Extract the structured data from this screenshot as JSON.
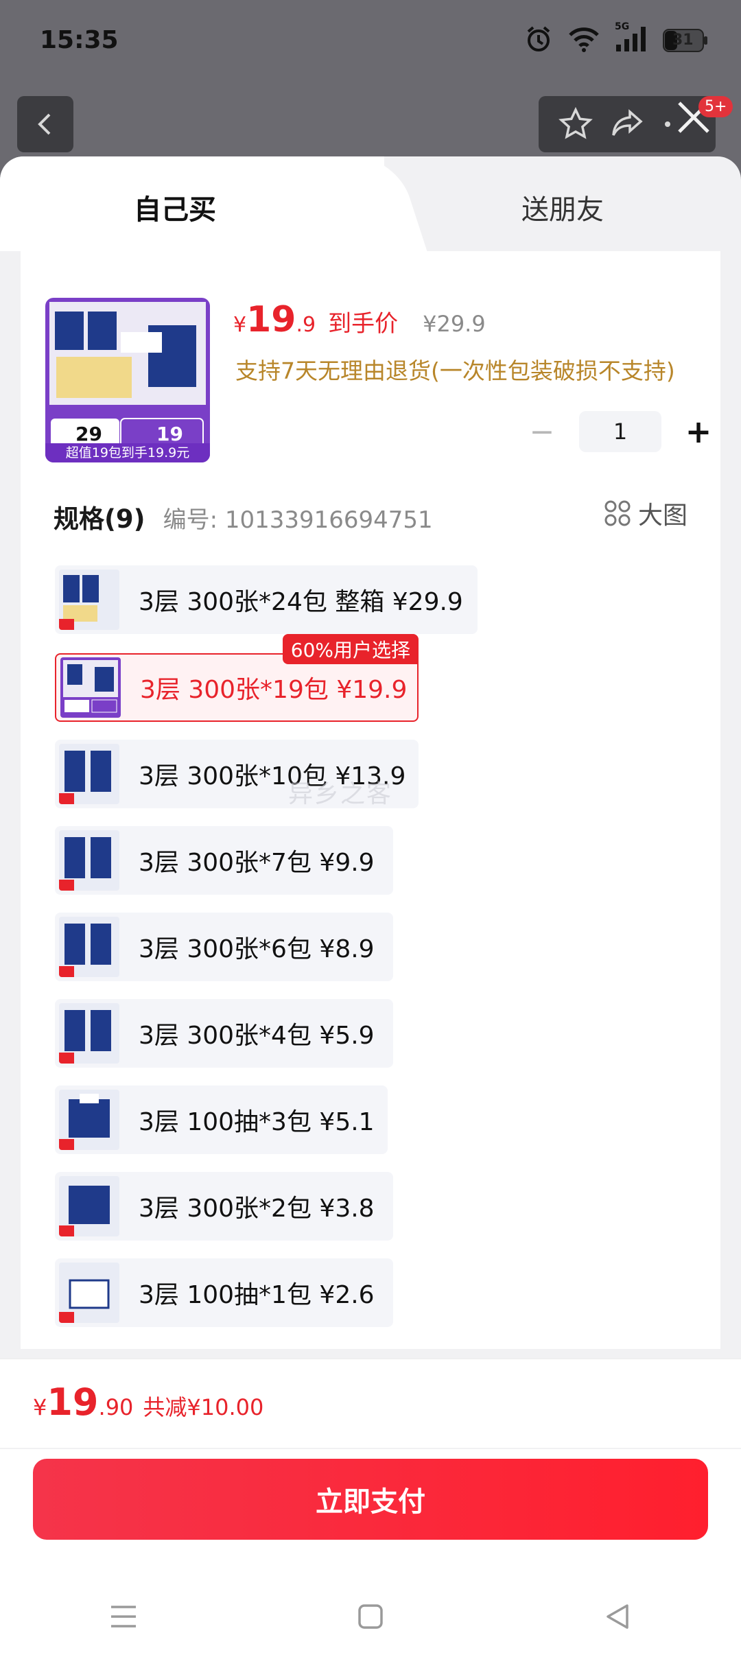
{
  "status_bar": {
    "time": "15:35",
    "network": "5G",
    "battery": "31"
  },
  "header": {
    "badge": "5+"
  },
  "tabs": [
    {
      "label": "自己买"
    },
    {
      "label": "送朋友"
    }
  ],
  "product": {
    "price_symbol": "¥",
    "price_int": "19",
    "price_dec": ".9",
    "price_tag": "到手价",
    "original_price": "¥29.9",
    "return_note": "支持7天无理由退货(一次性包装破损不支持)",
    "quantity": "1",
    "image_caption": "超值19包到手19.9元"
  },
  "spec": {
    "title": "规格(9)",
    "code": "编号: 10133916694751",
    "big_pic_label": "大图",
    "popular_tag": "60%用户选择",
    "options": [
      {
        "label": "3层 300张*24包 整箱   ¥29.9",
        "count": "24"
      },
      {
        "label": "3层 300张*19包   ¥19.9",
        "count": "19",
        "selected": true
      },
      {
        "label": "3层 300张*10包   ¥13.9",
        "count": "10"
      },
      {
        "label": "3层 300张*7包   ¥9.9",
        "count": "7"
      },
      {
        "label": "3层 300张*6包   ¥8.9",
        "count": "6"
      },
      {
        "label": "3层 300张*4包   ¥5.9",
        "count": "4"
      },
      {
        "label": "3层 100抽*3包   ¥5.1",
        "count": "3"
      },
      {
        "label": "3层 300张*2包   ¥3.8",
        "count": "2"
      },
      {
        "label": "3层 100抽*1包   ¥2.6",
        "count": "1"
      }
    ]
  },
  "watermark": "异乡之客",
  "footer": {
    "price_symbol": "¥",
    "price_int": "19",
    "price_dec": ".90",
    "saving": "共减¥10.00",
    "pay_label": "立即支付"
  },
  "colors": {
    "accent": "#e8232b",
    "note": "#b8862a"
  }
}
